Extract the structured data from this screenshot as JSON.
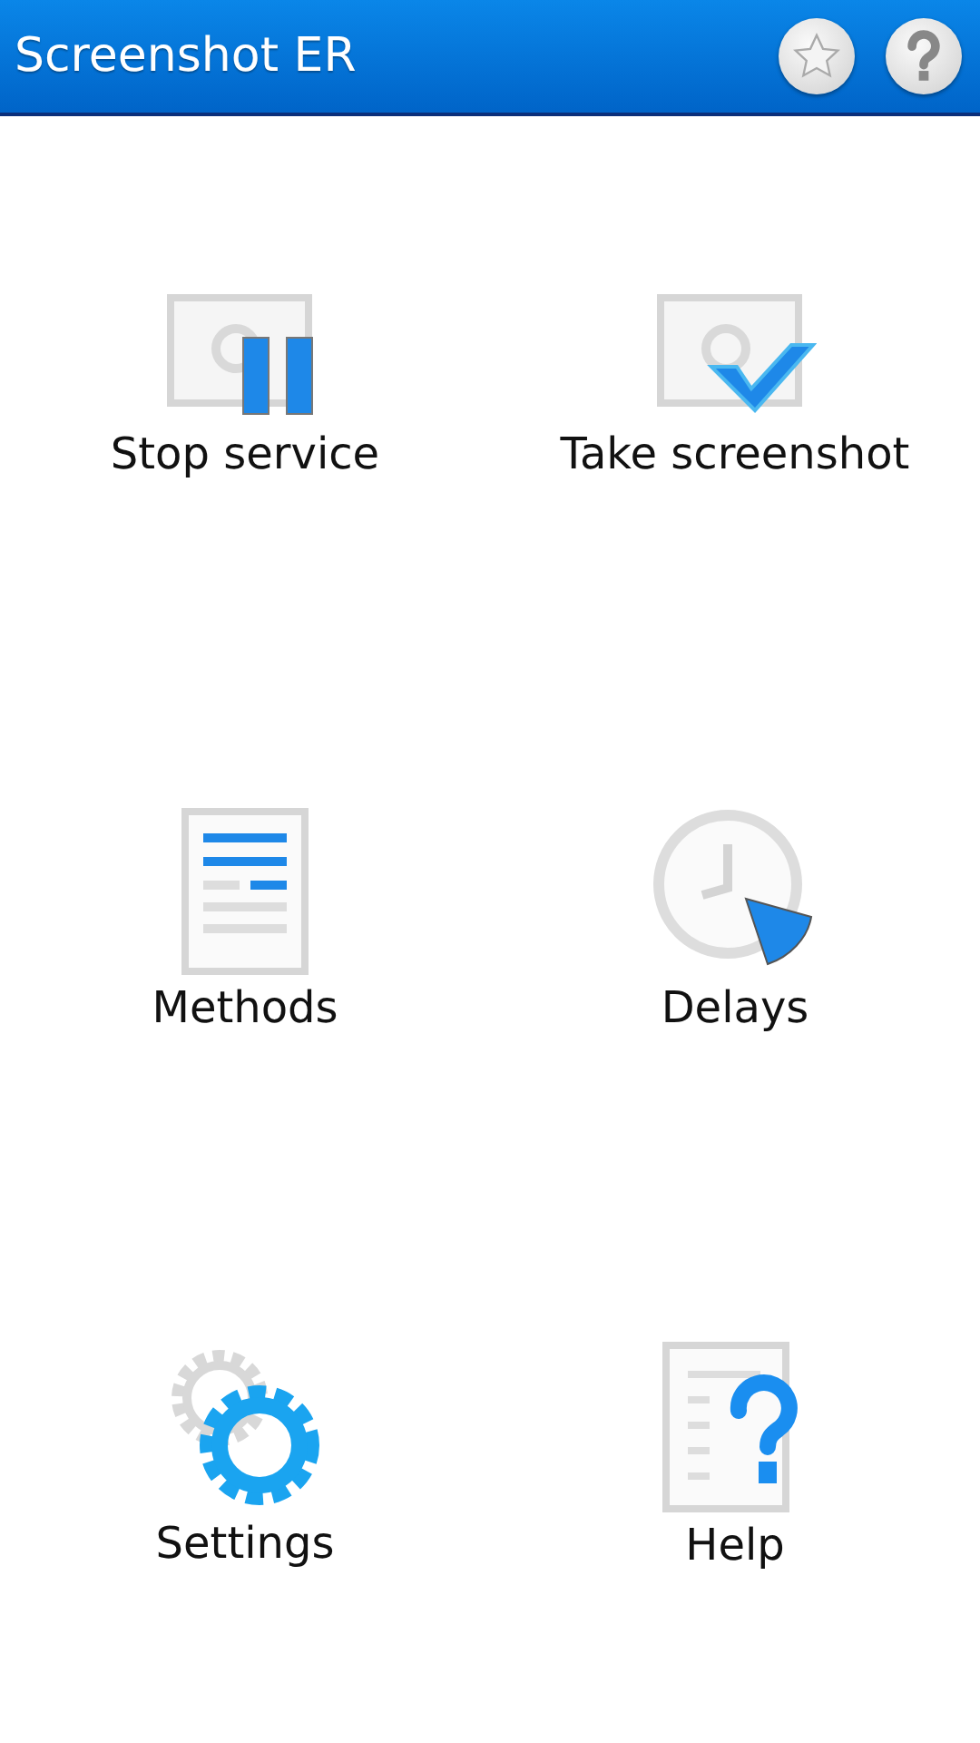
{
  "action_bar": {
    "title": "Screenshot ER",
    "actions": [
      {
        "kind": "star"
      },
      {
        "kind": "help"
      }
    ]
  },
  "items": [
    {
      "label": "Stop service",
      "kind": "stop"
    },
    {
      "label": "Take screenshot",
      "kind": "capture"
    },
    {
      "label": "Methods",
      "kind": "methods"
    },
    {
      "label": "Delays",
      "kind": "delays"
    },
    {
      "label": "Settings",
      "kind": "settings"
    },
    {
      "label": "Help",
      "kind": "help"
    }
  ]
}
